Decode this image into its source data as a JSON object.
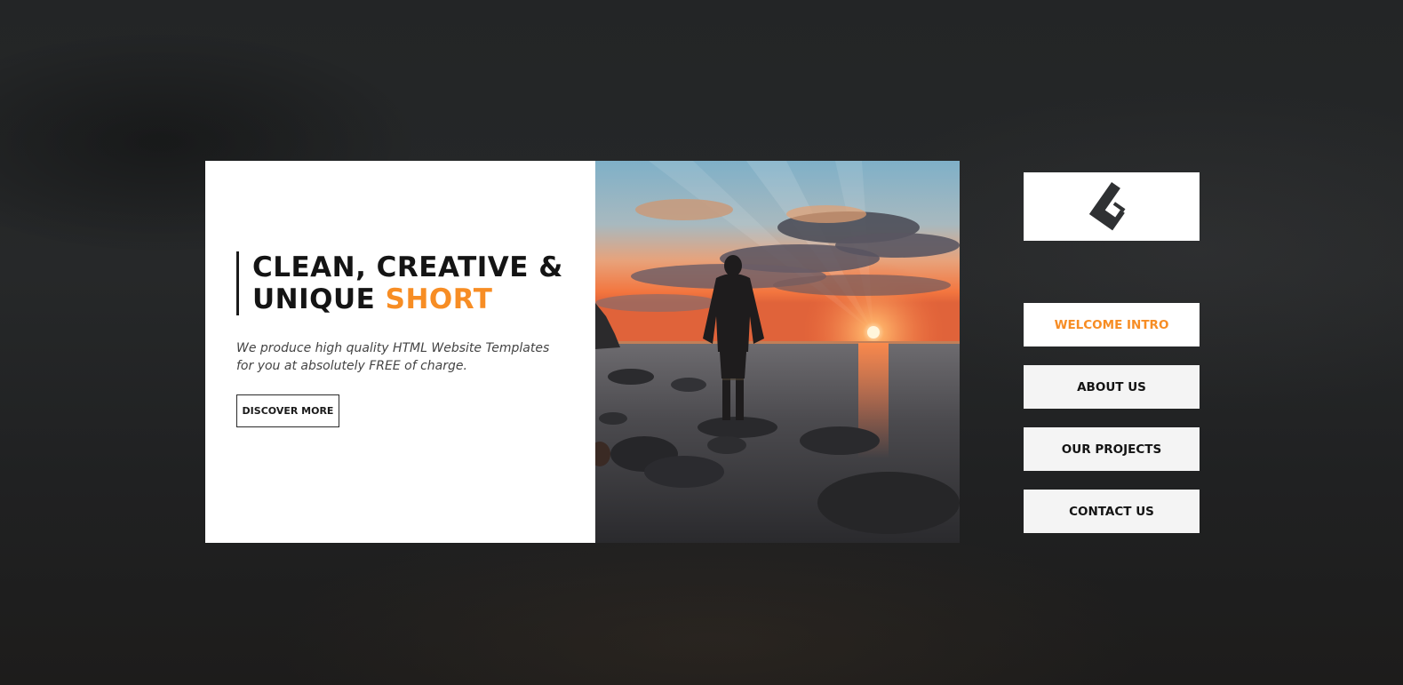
{
  "hero": {
    "headline_line1": "CLEAN, CREATIVE &",
    "headline_line2_prefix": "UNIQUE",
    "headline_line2_accent": "SHORT",
    "tagline": "We produce high quality HTML Website Templates for you at absolutely FREE of charge.",
    "cta_label": "DISCOVER MORE"
  },
  "logo": {
    "icon": "brand-logo-icon"
  },
  "nav": {
    "items": [
      {
        "label": "WELCOME INTRO",
        "active": true
      },
      {
        "label": "ABOUT US",
        "active": false
      },
      {
        "label": "OUR PROJECTS",
        "active": false
      },
      {
        "label": "CONTACT US",
        "active": false
      }
    ]
  },
  "colors": {
    "accent": "#f78d24",
    "background": "#232526",
    "card": "#ffffff",
    "nav_item": "#f4f4f4",
    "text_dark": "#141414"
  }
}
